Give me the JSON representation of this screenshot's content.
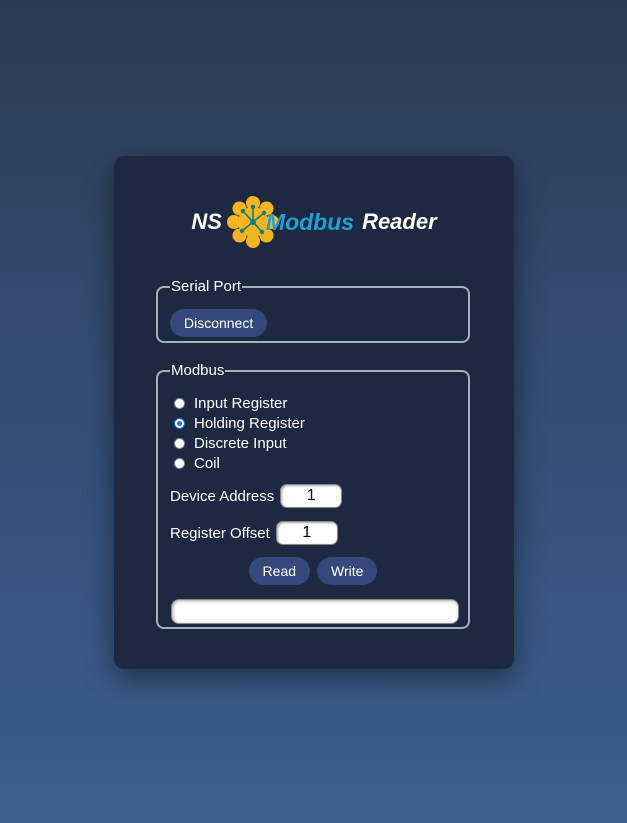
{
  "logo": {
    "prefix": "NS",
    "brand": "Modbus",
    "suffix": "Reader",
    "brand_color": "#1fa0d8",
    "gear_color": "#f5b51e"
  },
  "serial_port": {
    "legend": "Serial Port",
    "button_label": "Disconnect"
  },
  "modbus": {
    "legend": "Modbus",
    "options": [
      {
        "label": "Input Register",
        "checked": false
      },
      {
        "label": "Holding Register",
        "checked": true
      },
      {
        "label": "Discrete Input",
        "checked": false
      },
      {
        "label": "Coil",
        "checked": false
      }
    ],
    "device_address": {
      "label": "Device Address",
      "value": "1"
    },
    "register_offset": {
      "label": "Register Offset",
      "value": "1"
    },
    "read_label": "Read",
    "write_label": "Write",
    "result_value": ""
  },
  "colors": {
    "card": "#1c2940",
    "button": "#34497a",
    "border": "#a9b0bc"
  }
}
